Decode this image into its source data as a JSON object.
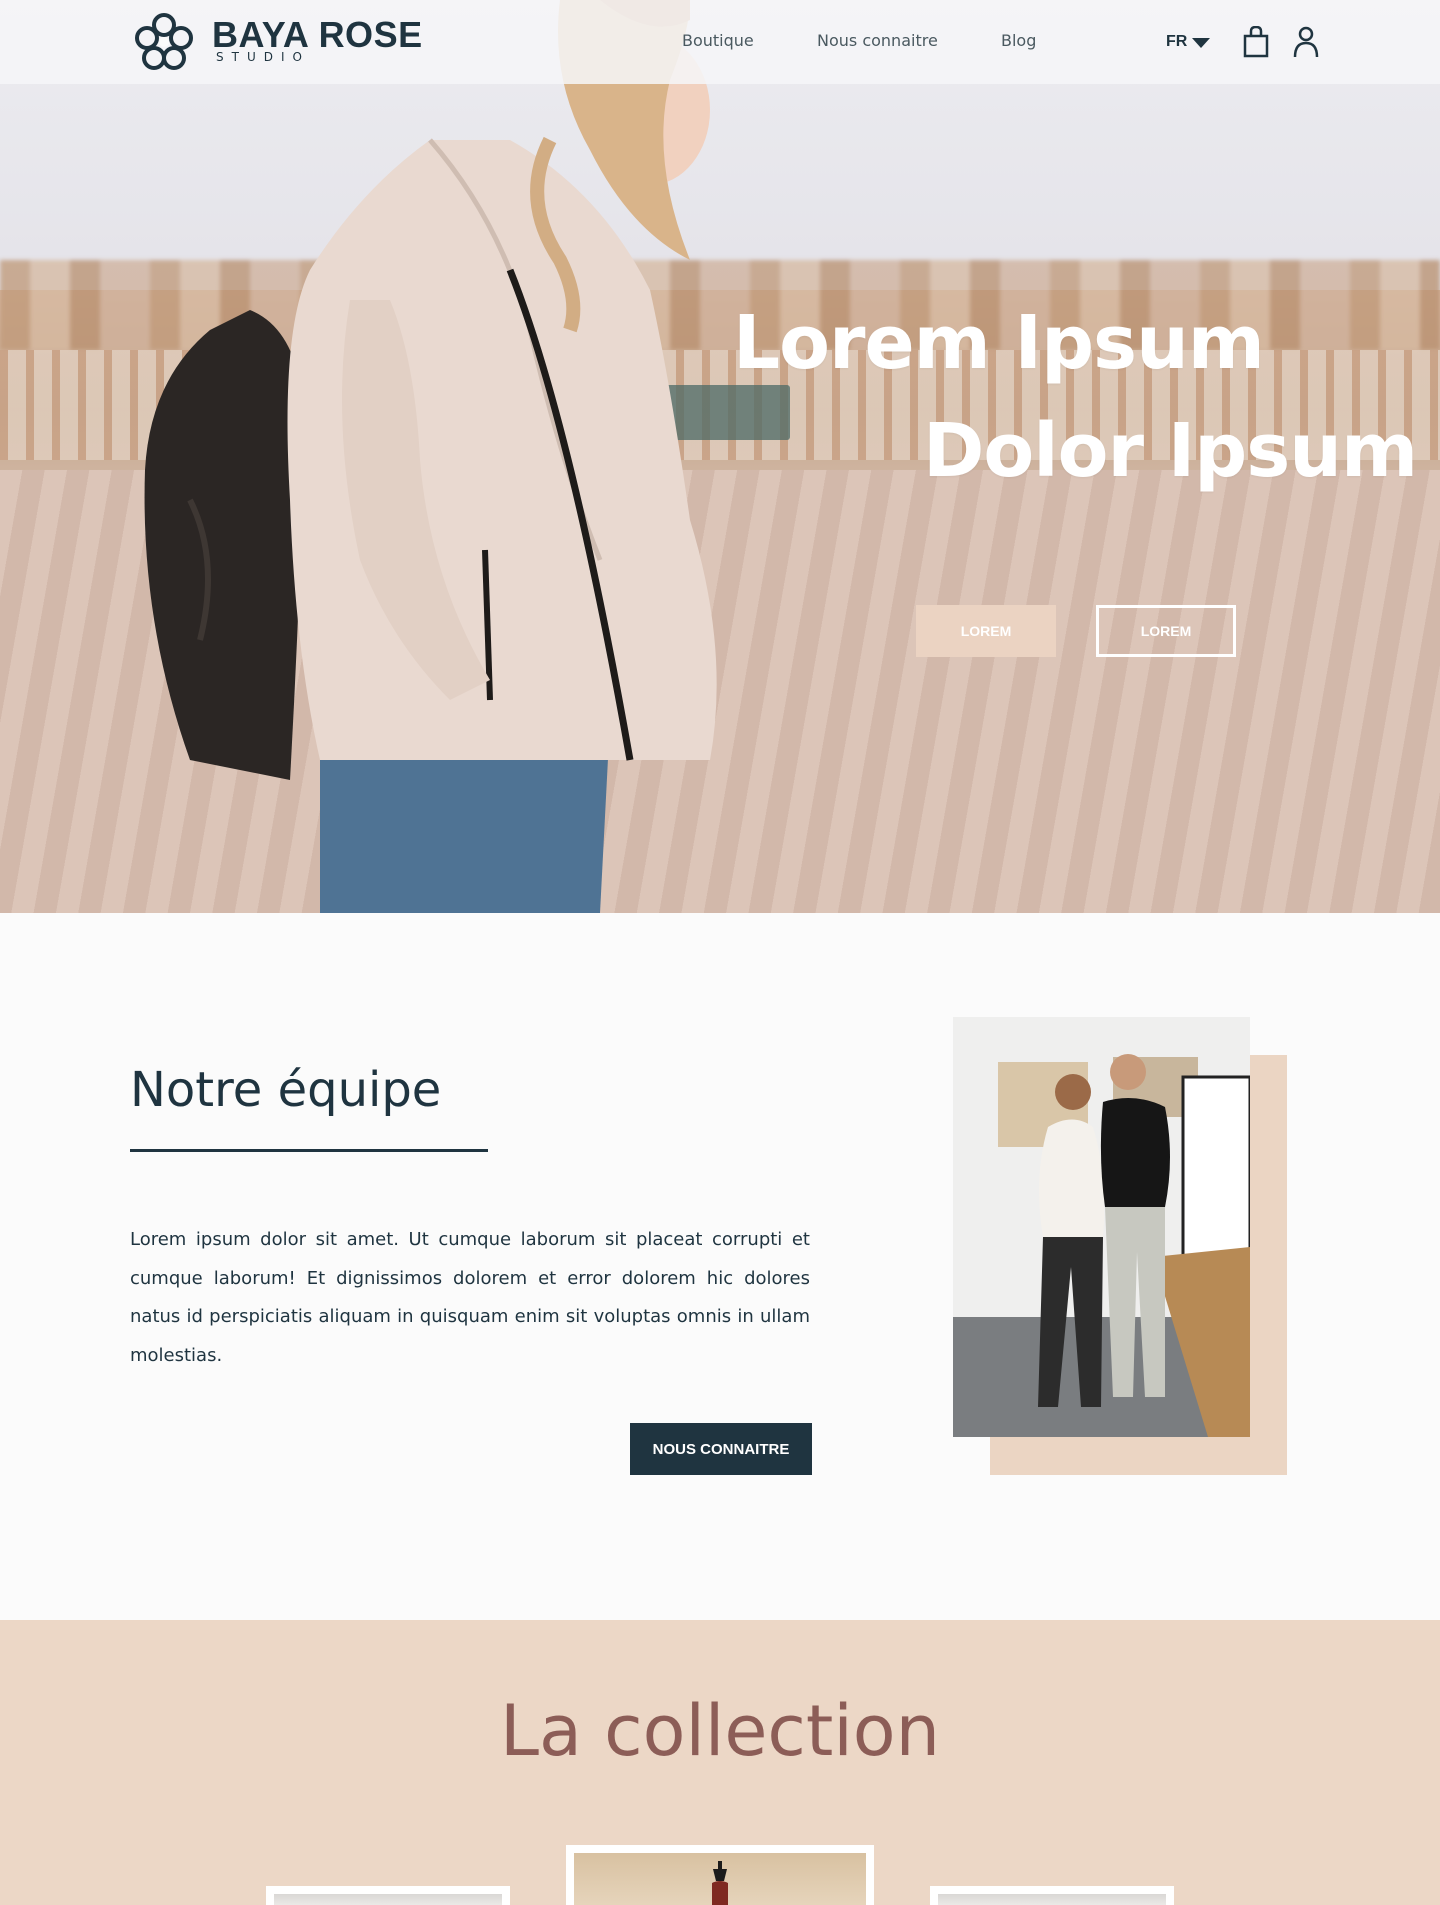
{
  "nav": {
    "brand_name": "BAYA ROSE",
    "brand_sub": "STUDIO",
    "links": [
      "Boutique",
      "Nous connaitre",
      "Blog"
    ],
    "language": "FR",
    "cart_icon": "shopping-bag-icon",
    "account_icon": "user-icon"
  },
  "hero": {
    "title_line1": "Lorem Ipsum",
    "title_line2": "Dolor Ipsum",
    "primary_button": "LOREM",
    "secondary_button": "LOREM"
  },
  "team": {
    "title": "Notre équipe",
    "text": "Lorem ipsum dolor sit amet. Ut cumque laborum sit placeat corrupti et cumque laborum! Et dignissimos dolorem et error dolorem hic dolores natus id perspiciatis aliquam in quisquam enim sit voluptas omnis in ullam molestias.",
    "button": "NOUS CONNAITRE"
  },
  "collection": {
    "title": "La collection"
  },
  "colors": {
    "dark": "#1f3440",
    "blush": "#ebd3c2",
    "collection_bg": "#ecd7c6",
    "collection_title": "#8c5d57"
  }
}
